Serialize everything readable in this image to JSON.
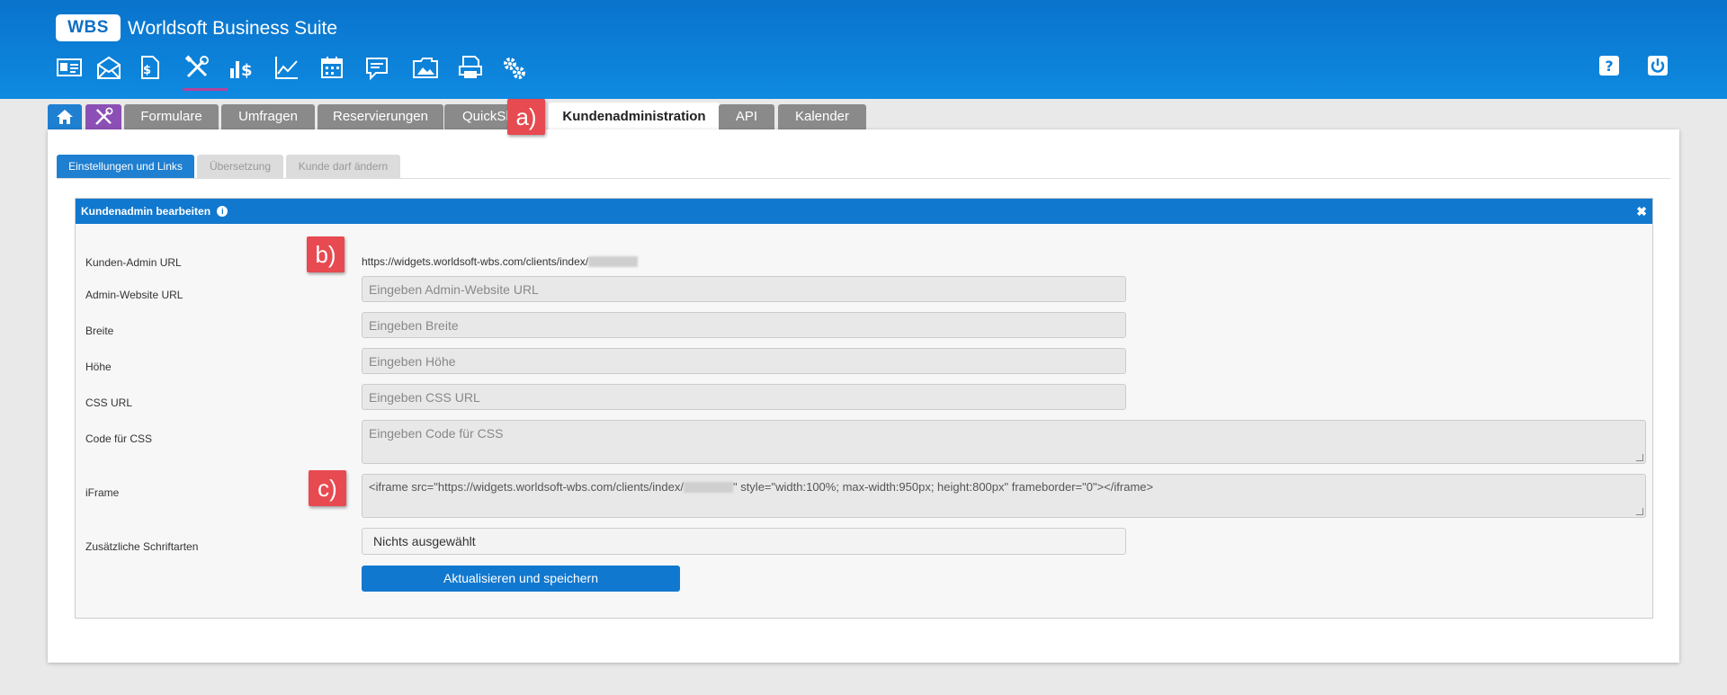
{
  "app": {
    "logo": "WBS",
    "title": "Worldsoft Business Suite"
  },
  "nav_icons": [
    "id-card-icon",
    "mail-icon",
    "document-money-icon",
    "tools-icon",
    "bar-chart-dollar-icon",
    "line-chart-icon",
    "calendar-icon",
    "comment-icon",
    "folder-image-icon",
    "printer-document-icon",
    "gears-icon"
  ],
  "header_right": {
    "help_icon": "help-icon",
    "power_icon": "power-icon"
  },
  "tabs": [
    {
      "label": ""
    },
    {
      "label": ""
    },
    {
      "label": "Formulare"
    },
    {
      "label": "Umfragen"
    },
    {
      "label": "Reservierungen"
    },
    {
      "label": "QuickSh"
    },
    {
      "label": "Kundenadministration"
    },
    {
      "label": "API"
    },
    {
      "label": "Kalender"
    }
  ],
  "subtabs": [
    {
      "label": "Einstellungen und Links"
    },
    {
      "label": "Übersetzung"
    },
    {
      "label": "Kunde darf ändern"
    }
  ],
  "panel": {
    "title": "Kundenadmin bearbeiten",
    "close": "✖"
  },
  "form": {
    "kunden_admin_url": {
      "label": "Kunden-Admin URL",
      "value": "https://widgets.worldsoft-wbs.com/clients/index/"
    },
    "admin_website_url": {
      "label": "Admin-Website URL",
      "placeholder": "Eingeben Admin-Website URL"
    },
    "breite": {
      "label": "Breite",
      "placeholder": "Eingeben Breite"
    },
    "hoehe": {
      "label": "Höhe",
      "placeholder": "Eingeben Höhe"
    },
    "css_url": {
      "label": "CSS URL",
      "placeholder": "Eingeben CSS URL"
    },
    "code_css": {
      "label": "Code für CSS",
      "placeholder": "Eingeben Code für CSS"
    },
    "iframe": {
      "label": "iFrame",
      "value_start": "<iframe src=\"https://widgets.worldsoft-wbs.com/clients/index/",
      "value_end": "\" style=\"width:100%; max-width:950px; height:800px\" frameborder=\"0\"></iframe>"
    },
    "schriftarten": {
      "label": "Zusätzliche Schriftarten",
      "value": "Nichts ausgewählt"
    },
    "submit": "Aktualisieren und speichern"
  },
  "markers": {
    "a": "a)",
    "b": "b)",
    "c": "c)"
  }
}
